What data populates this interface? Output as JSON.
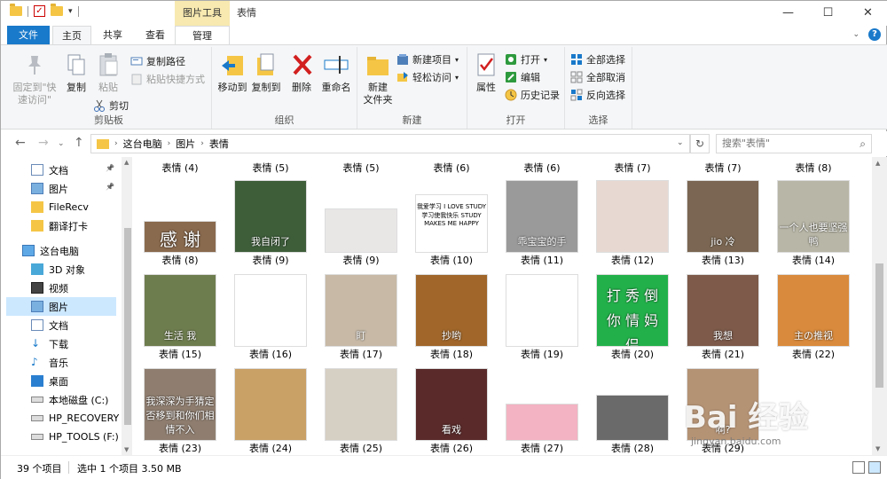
{
  "window": {
    "title": "表情",
    "context_tool": "图片工具"
  },
  "quick_access": {
    "icons": [
      "folder-icon",
      "properties-check-icon",
      "new-folder-icon",
      "dropdown-icon"
    ]
  },
  "window_buttons": {
    "minimize": "—",
    "maximize": "☐",
    "close": "✕"
  },
  "tabs": {
    "file": "文件",
    "home": "主页",
    "share": "共享",
    "view": "查看",
    "manage": "管理"
  },
  "ribbon": {
    "clipboard": {
      "label": "剪贴板",
      "pin": "固定到\"快\n速访问\"",
      "copy": "复制",
      "paste": "粘贴",
      "copy_path": "复制路径",
      "paste_shortcut": "粘贴快捷方式",
      "cut": "剪切"
    },
    "organize": {
      "label": "组织",
      "move_to": "移动到",
      "copy_to": "复制到",
      "delete": "删除",
      "rename": "重命名"
    },
    "new": {
      "label": "新建",
      "new_folder": "新建\n文件夹",
      "new_item": "新建项目",
      "easy_access": "轻松访问"
    },
    "open": {
      "label": "打开",
      "properties": "属性",
      "open": "打开",
      "edit": "编辑",
      "history": "历史记录"
    },
    "select": {
      "label": "选择",
      "select_all": "全部选择",
      "select_none": "全部取消",
      "invert": "反向选择"
    }
  },
  "nav": {
    "breadcrumb": [
      "这台电脑",
      "图片",
      "表情"
    ],
    "search_placeholder": "搜索\"表情\""
  },
  "sidebar": {
    "items": [
      {
        "label": "文档",
        "icon": "documents-icon",
        "pinned": true
      },
      {
        "label": "图片",
        "icon": "pictures-icon",
        "pinned": true
      },
      {
        "label": "FileRecv",
        "icon": "folder-icon",
        "pinned": false
      },
      {
        "label": "翻译打卡",
        "icon": "folder-icon",
        "pinned": false
      },
      {
        "label": "这台电脑",
        "icon": "computer-icon",
        "pinned": false
      },
      {
        "label": "3D 对象",
        "icon": "3d-objects-icon",
        "pinned": false
      },
      {
        "label": "视频",
        "icon": "videos-icon",
        "pinned": false
      },
      {
        "label": "图片",
        "icon": "pictures-icon",
        "pinned": false,
        "selected": true
      },
      {
        "label": "文档",
        "icon": "documents-icon",
        "pinned": false
      },
      {
        "label": "下载",
        "icon": "downloads-icon",
        "pinned": false
      },
      {
        "label": "音乐",
        "icon": "music-icon",
        "pinned": false
      },
      {
        "label": "桌面",
        "icon": "desktop-icon",
        "pinned": false
      },
      {
        "label": "本地磁盘 (C:)",
        "icon": "drive-icon",
        "pinned": false
      },
      {
        "label": "HP_RECOVERY",
        "icon": "drive-icon",
        "pinned": false
      },
      {
        "label": "HP_TOOLS (F:)",
        "icon": "drive-icon",
        "pinned": false
      }
    ]
  },
  "files": {
    "top_labels": [
      "表情 (4)",
      "表情 (5)",
      "表情 (5)",
      "表情 (6)",
      "表情 (6)",
      "表情 (7)",
      "表情 (7)",
      "表情 (8)"
    ],
    "rows": [
      [
        {
          "label": "表情 (8)",
          "caption": "感 谢",
          "bg": "#8a6a4e"
        },
        {
          "label": "表情 (9)",
          "caption": "我自闭了",
          "bg": "#3e5e3a"
        },
        {
          "label": "表情 (9)",
          "caption": "",
          "bg": "#e9e6e6"
        },
        {
          "label": "表情 (10)",
          "caption": "我爱学习 I LOVE STUDY 学习使我快乐 STUDY MAKES ME HAPPY",
          "bg": "#ffffff"
        },
        {
          "label": "表情 (11)",
          "caption": "乖宝宝的手",
          "bg": "#9a9a9a"
        },
        {
          "label": "表情 (12)",
          "caption": "",
          "bg": "#e8d8d2"
        },
        {
          "label": "表情 (13)",
          "caption": "jio 冷",
          "bg": "#7a6652"
        },
        {
          "label": "表情 (14)",
          "caption": "一个人也要坚强鸭",
          "bg": "#b8b6a6"
        }
      ],
      [
        {
          "label": "表情 (15)",
          "caption": "生活 我",
          "bg": "#6e7d4e"
        },
        {
          "label": "表情 (16)",
          "caption": "",
          "bg": "#ffffff"
        },
        {
          "label": "表情 (17)",
          "caption": "盯",
          "bg": "#c7b9a6"
        },
        {
          "label": "表情 (18)",
          "caption": "抄哟",
          "bg": "#a0662a"
        },
        {
          "label": "表情 (19)",
          "caption": "",
          "bg": "#ffffff"
        },
        {
          "label": "表情 (20)",
          "caption": "打 秀 倒 你 情 妈 侣",
          "bg": "#22b04a"
        },
        {
          "label": "表情 (21)",
          "caption": "我想",
          "bg": "#7d5a4a"
        },
        {
          "label": "表情 (22)",
          "caption": "主の推视",
          "bg": "#d98a3c"
        }
      ],
      [
        {
          "label": "表情 (23)",
          "caption": "我深深为手猜定 否移到和你们相情不入",
          "bg": "#8f7e70"
        },
        {
          "label": "表情 (24)",
          "caption": "",
          "bg": "#c9a066"
        },
        {
          "label": "表情 (25)",
          "caption": "",
          "bg": "#d6cfc3"
        },
        {
          "label": "表情 (26)",
          "caption": "看戏",
          "bg": "#5a2a2a"
        },
        {
          "label": "表情 (27)",
          "caption": "",
          "bg": "#f3b3c2"
        },
        {
          "label": "表情 (28)",
          "caption": "",
          "bg": "#6a6a6a"
        },
        {
          "label": "表情 (29)",
          "caption": "啊?",
          "bg": "#b49274"
        },
        {
          "label": "",
          "caption": "",
          "bg": "#ffffff"
        }
      ]
    ]
  },
  "status": {
    "count": "39 个项目",
    "selected": "选中 1 个项目  3.50 MB"
  },
  "watermark": {
    "brand": "Bai  经验",
    "url": "jingyan.baidu.com"
  },
  "colors": {
    "accent": "#1979ca",
    "selected_bg": "#cce8ff",
    "ribbon_bg": "#f5f6f7",
    "context_tab": "#f7e9b0"
  }
}
